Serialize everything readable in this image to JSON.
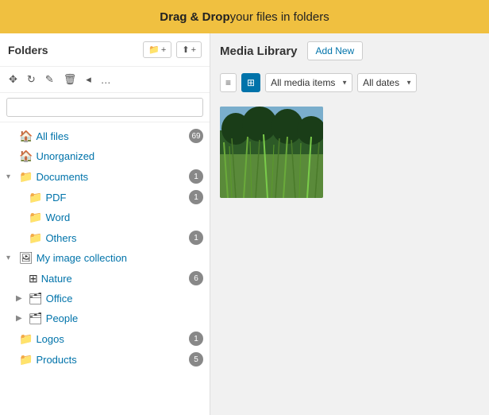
{
  "banner": {
    "bold": "Drag & Drop",
    "rest": " your files in folders"
  },
  "left": {
    "folders_label": "Folders",
    "new_folder_label": "+",
    "upload_label": "+",
    "toolbar": {
      "move": "✥",
      "refresh": "↻",
      "edit": "✎",
      "delete": "🗑",
      "more1": "◂",
      "more2": "…"
    },
    "search_placeholder": "",
    "tree": [
      {
        "id": "all-files",
        "level": 0,
        "icon": "🏠",
        "label": "All files",
        "badge": "69",
        "chevron": ""
      },
      {
        "id": "unorganized",
        "level": 0,
        "icon": "🏠",
        "label": "Unorganized",
        "badge": "",
        "chevron": ""
      },
      {
        "id": "documents",
        "level": 0,
        "icon": "📁",
        "label": "Documents",
        "badge": "1",
        "chevron": "▾",
        "expanded": true
      },
      {
        "id": "pdf",
        "level": 1,
        "icon": "📁",
        "label": "PDF",
        "badge": "1",
        "chevron": ""
      },
      {
        "id": "word",
        "level": 1,
        "icon": "📁",
        "label": "Word",
        "badge": "",
        "chevron": ""
      },
      {
        "id": "others",
        "level": 1,
        "icon": "📁",
        "label": "Others",
        "badge": "1",
        "chevron": ""
      },
      {
        "id": "my-image-collection",
        "level": 0,
        "icon": "🖼",
        "label": "My image collection",
        "badge": "",
        "chevron": "▾",
        "expanded": true
      },
      {
        "id": "nature",
        "level": 1,
        "icon": "⊞",
        "label": "Nature",
        "badge": "6",
        "chevron": ""
      },
      {
        "id": "office",
        "level": 1,
        "icon": "🖿",
        "label": "Office",
        "badge": "",
        "chevron": "▶"
      },
      {
        "id": "people",
        "level": 1,
        "icon": "🖿",
        "label": "People",
        "badge": "",
        "chevron": "▶"
      },
      {
        "id": "logos",
        "level": 0,
        "icon": "📁",
        "label": "Logos",
        "badge": "1",
        "chevron": ""
      },
      {
        "id": "products",
        "level": 0,
        "icon": "📁",
        "label": "Products",
        "badge": "5",
        "chevron": ""
      }
    ]
  },
  "right": {
    "title": "Media Library",
    "add_new": "Add New",
    "filter_type": "All media items",
    "filter_date": "All dates",
    "view_list_icon": "≡",
    "view_grid_icon": "⊞",
    "media_items": [
      {
        "id": "grass",
        "type": "image",
        "alt": "Grass field"
      }
    ]
  }
}
